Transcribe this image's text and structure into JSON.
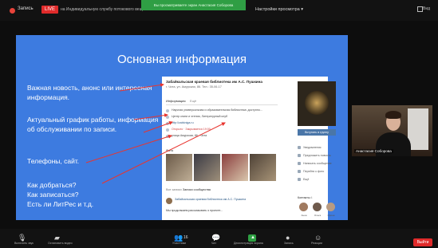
{
  "topbar": {
    "rec_label": "Запись",
    "live_badge": "LIVE",
    "stream_text": "на Индивидуальную службу потокового вещания",
    "viewing_banner": "Вы просматриваете экран Анастасия Соборова",
    "view_options": "Настройки просмотра ▾",
    "view_label": "Вид"
  },
  "slide": {
    "title": "Основная информация",
    "bullets": [
      "Важная новость, анонс или интересная информация.",
      "Актуальный график работы, информация об обслуживании по записи.",
      "Телефоны, сайт.",
      "Как добраться?\nКак записаться?\nЕсть ли ЛитРес и т.д."
    ],
    "arrow_color": "#e8352f"
  },
  "vk_card": {
    "title": "Забайкальская краевая библиотека им А.С. Пушкина",
    "subtitle": "г. Чита, ул. Амурская, 86. Тел.: 35-06-17",
    "tab_info": "Информация",
    "tab_other": "Ещё",
    "lines": [
      "Научная универсальная и образовательная библиотека: доступно...",
      "Центр книги и чтения, Литературный клуб",
      "http://zabkniga.ru",
      "Открыто · Закрывается 19:00",
      "улица Амурская, 86 · Чита"
    ],
    "join_button": "Вступить в группу",
    "photos_label": "Фото",
    "right_menu": [
      "Уведомления",
      "Предложить новость",
      "Написать сообщение",
      "Перейти к фото",
      "Ещё"
    ],
    "feed_tab_all": "Все записи",
    "feed_tab_group": "Записи сообщества",
    "post_author": "Забайкальская краевая библиотека им А.С. Пушкина",
    "post_text": "Мы продолжаем рассказывать о проекте...",
    "contacts_label": "Контакты",
    "contact_count": "4",
    "contact_names": [
      "Анна",
      "Ольга",
      "Ирина"
    ]
  },
  "participant": {
    "name": "Анастасия Соборова"
  },
  "toolbar": {
    "items": [
      {
        "icon": "microphone-icon",
        "label": "Включить звук"
      },
      {
        "icon": "video-camera-icon",
        "label": "Остановить видео"
      },
      {
        "icon": "participants-icon",
        "label": "Участники",
        "count": "16"
      },
      {
        "icon": "chat-icon",
        "label": "Чат"
      },
      {
        "icon": "share-screen-icon",
        "label": "Демонстрация экрана"
      },
      {
        "icon": "record-icon",
        "label": "Запись"
      },
      {
        "icon": "reactions-icon",
        "label": "Реакции"
      }
    ],
    "leave_label": "Выйти"
  },
  "colors": {
    "slide_blue": "#3d7be0",
    "banner_green": "#2f9e44",
    "leave_red": "#e02b2b",
    "vk_blue": "#4a76a8"
  }
}
